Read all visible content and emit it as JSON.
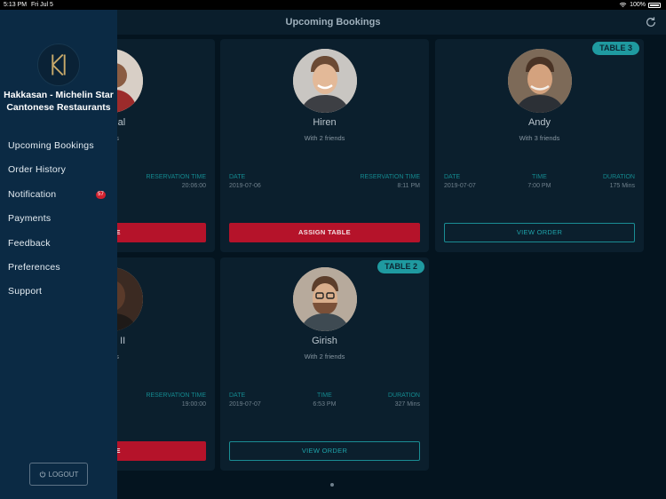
{
  "status_bar": {
    "time": "5:13 PM",
    "date": "Fri Jul 5",
    "battery": "100%"
  },
  "header": {
    "title": "Upcoming Bookings"
  },
  "bookings": [
    {
      "name": "anchal",
      "friends": "iends",
      "date_label": "",
      "date": "",
      "time_label": "RESERVATION TIME",
      "time": "20:06:00",
      "button": "ABLE"
    },
    {
      "name": "Hiren",
      "friends": "With 2 friends",
      "date_label": "DATE",
      "date": "2019-07-06",
      "time_label": "RESERVATION TIME",
      "time": "8:11 PM",
      "button": "ASSIGN TABLE"
    },
    {
      "name": "Andy",
      "friends": "With 3 friends",
      "table": "TABLE 3",
      "date_label": "DATE",
      "date": "2019-07-07",
      "time_label": "TIME",
      "time": "7:00 PM",
      "duration_label": "DURATION",
      "duration": "175 Mins",
      "button": "VIEW ORDER"
    },
    {
      "name": "ustin II",
      "friends": "iends",
      "date_label": "",
      "date": "",
      "time_label": "RESERVATION TIME",
      "time": "19:00:00",
      "button": "ABLE"
    },
    {
      "name": "Girish",
      "friends": "With 2 friends",
      "table": "TABLE 2",
      "date_label": "DATE",
      "date": "2019-07-07",
      "time_label": "TIME",
      "time": "6:53 PM",
      "duration_label": "DURATION",
      "duration": "327 Mins",
      "button": "VIEW ORDER"
    }
  ],
  "drawer": {
    "restaurant": "Hakkasan - Michelin Star Cantonese Restaurants",
    "menu": [
      "Upcoming Bookings",
      "Order History",
      "Notification",
      "Payments",
      "Feedback",
      "Preferences",
      "Support"
    ],
    "notification_count": "57",
    "logout": "LOGOUT"
  },
  "colors": {
    "accent": "#1f9aa0",
    "danger": "#b5132a",
    "drawer": "#0b2a44",
    "background": "#04141f"
  },
  "icons": {
    "refresh": "refresh-icon",
    "wifi": "wifi-icon",
    "power": "power-icon",
    "logo": "hakkasan-logo"
  }
}
